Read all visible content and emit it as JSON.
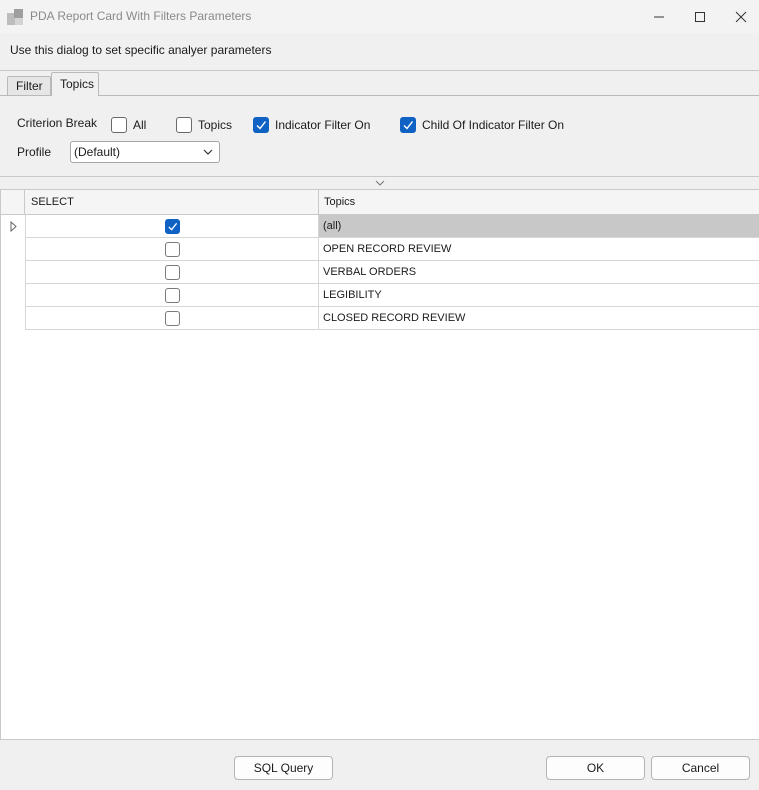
{
  "window": {
    "title": "PDA Report Card With Filters Parameters",
    "icon": "app-window-icon"
  },
  "description": "Use this dialog to set specific analyer parameters",
  "tabs": [
    {
      "label": "Filter",
      "active": false
    },
    {
      "label": "Topics",
      "active": true
    }
  ],
  "filters": {
    "criterion_break_label": "Criterion Break",
    "options": [
      {
        "label": "All",
        "checked": false
      },
      {
        "label": "Topics",
        "checked": false
      },
      {
        "label": "Indicator Filter On",
        "checked": true
      },
      {
        "label": "Child Of Indicator Filter On",
        "checked": true
      }
    ],
    "profile_label": "Profile",
    "profile_value": "(Default)"
  },
  "grid": {
    "columns": [
      "SELECT",
      "Topics"
    ],
    "rows": [
      {
        "selected": true,
        "checked": true,
        "topic": "(all)"
      },
      {
        "selected": false,
        "checked": false,
        "topic": "OPEN RECORD REVIEW"
      },
      {
        "selected": false,
        "checked": false,
        "topic": "VERBAL ORDERS"
      },
      {
        "selected": false,
        "checked": false,
        "topic": "LEGIBILITY"
      },
      {
        "selected": false,
        "checked": false,
        "topic": "CLOSED RECORD REVIEW"
      }
    ]
  },
  "footer": {
    "sql_label": "SQL Query",
    "ok_label": "OK",
    "cancel_label": "Cancel"
  },
  "colors": {
    "accent": "#0f62c4",
    "selected_row": "#c8c8c8"
  }
}
